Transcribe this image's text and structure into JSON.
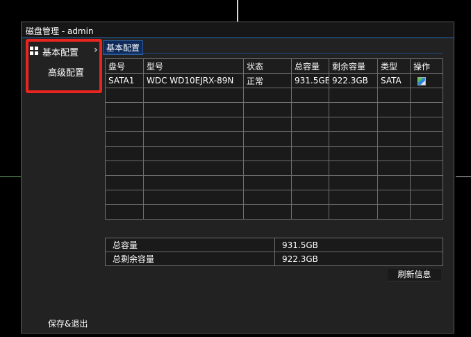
{
  "window": {
    "title": "磁盘管理 - admin"
  },
  "sidebar": {
    "items": [
      {
        "label": "基本配置",
        "icon": "grid-icon",
        "selected": true
      },
      {
        "label": "高级配置"
      }
    ],
    "save_exit_label": "保存&退出"
  },
  "tab": {
    "label": "基本配置"
  },
  "table": {
    "columns": [
      "盘号",
      "型号",
      "状态",
      "总容量",
      "剩余容量",
      "类型",
      "操作"
    ],
    "rows": [
      {
        "disk_no": "SATA1",
        "model": "WDC WD10EJRX-89N",
        "status": "正常",
        "total": "931.5GB",
        "free": "922.3GB",
        "type": "SATA",
        "action_icon": "disk-config-icon"
      }
    ],
    "empty_rows": 9
  },
  "summary": {
    "total_label": "总容量",
    "total_value": "931.5GB",
    "free_label": "总剩余容量",
    "free_value": "922.3GB"
  },
  "actions": {
    "refresh_label": "刷新信息"
  },
  "colors": {
    "background": "#000000",
    "panel": "#222222",
    "highlight_box": "#e8251f",
    "tab_bg": "#0d2a5a"
  }
}
